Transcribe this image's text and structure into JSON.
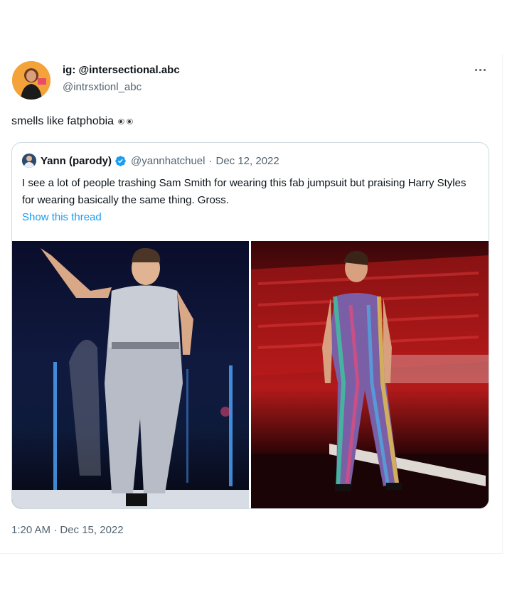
{
  "tweet": {
    "author": {
      "name": "ig: @intersectional.abc",
      "handle": "@intrsxtionl_abc"
    },
    "text": "smells like fatphobia",
    "timestamp": "1:20 AM · Dec 15, 2022"
  },
  "quoted_tweet": {
    "author_name": "Yann (parody)",
    "handle": "@yannhatchuel",
    "separator": "·",
    "date": "Dec 12, 2022",
    "text": "I see a lot of people trashing Sam Smith for wearing this fab jumpsuit but praising Harry Styles for wearing basically the same thing. Gross.",
    "thread_link": "Show this thread"
  },
  "colors": {
    "accent": "#1d9bf0",
    "secondary_text": "#536471",
    "border": "#cfd9de"
  },
  "icons": [
    "more-icon",
    "verified-icon",
    "eyes-emoji"
  ]
}
